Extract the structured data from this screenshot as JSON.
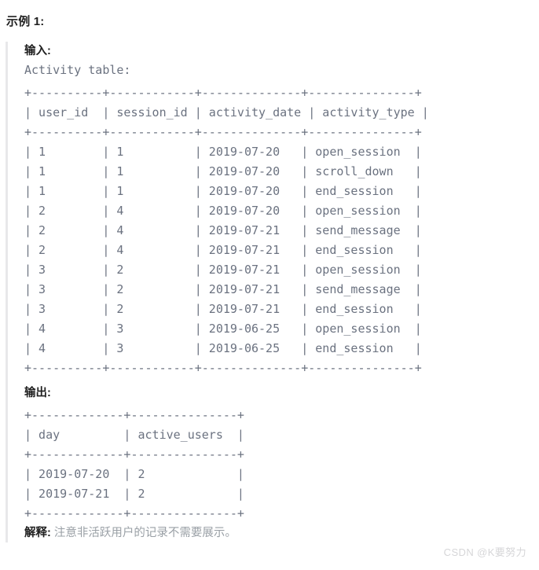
{
  "example": {
    "title": "示例 1:"
  },
  "input": {
    "label": "输入:",
    "caption": "Activity table:",
    "table_text": "+----------+------------+--------------+---------------+\n| user_id  | session_id | activity_date | activity_type |\n+----------+------------+--------------+---------------+\n| 1        | 1          | 2019-07-20   | open_session  |\n| 1        | 1          | 2019-07-20   | scroll_down   |\n| 1        | 1          | 2019-07-20   | end_session   |\n| 2        | 4          | 2019-07-20   | open_session  |\n| 2        | 4          | 2019-07-21   | send_message  |\n| 2        | 4          | 2019-07-21   | end_session   |\n| 3        | 2          | 2019-07-21   | open_session  |\n| 3        | 2          | 2019-07-21   | send_message  |\n| 3        | 2          | 2019-07-21   | end_session   |\n| 4        | 3          | 2019-06-25   | open_session  |\n| 4        | 3          | 2019-06-25   | end_session   |\n+----------+------------+--------------+---------------+"
  },
  "output": {
    "label": "输出:",
    "table_text": "+-------------+---------------+\n| day         | active_users  |\n+-------------+---------------+\n| 2019-07-20  | 2             |\n| 2019-07-21  | 2             |\n+-------------+---------------+"
  },
  "explanation": {
    "key": "解释:",
    "text": " 注意非活跃用户的记录不需要展示。"
  },
  "watermark": {
    "text": "CSDN @K要努力"
  },
  "table_data": {
    "activity_table": {
      "name": "Activity",
      "columns": [
        "user_id",
        "session_id",
        "activity_date",
        "activity_type"
      ],
      "rows": [
        [
          "1",
          "1",
          "2019-07-20",
          "open_session"
        ],
        [
          "1",
          "1",
          "2019-07-20",
          "scroll_down"
        ],
        [
          "1",
          "1",
          "2019-07-20",
          "end_session"
        ],
        [
          "2",
          "4",
          "2019-07-20",
          "open_session"
        ],
        [
          "2",
          "4",
          "2019-07-21",
          "send_message"
        ],
        [
          "2",
          "4",
          "2019-07-21",
          "end_session"
        ],
        [
          "3",
          "2",
          "2019-07-21",
          "open_session"
        ],
        [
          "3",
          "2",
          "2019-07-21",
          "send_message"
        ],
        [
          "3",
          "2",
          "2019-07-21",
          "end_session"
        ],
        [
          "4",
          "3",
          "2019-06-25",
          "open_session"
        ],
        [
          "4",
          "3",
          "2019-06-25",
          "end_session"
        ]
      ]
    },
    "result_table": {
      "columns": [
        "day",
        "active_users"
      ],
      "rows": [
        [
          "2019-07-20",
          "2"
        ],
        [
          "2019-07-21",
          "2"
        ]
      ]
    }
  },
  "colors": {
    "text_dark": "#1f1f1f",
    "text_mono": "#6b7280",
    "text_muted": "#9aa0a6",
    "quote_border": "#e8e8ea",
    "watermark": "#d6d6d8",
    "background": "#ffffff"
  }
}
